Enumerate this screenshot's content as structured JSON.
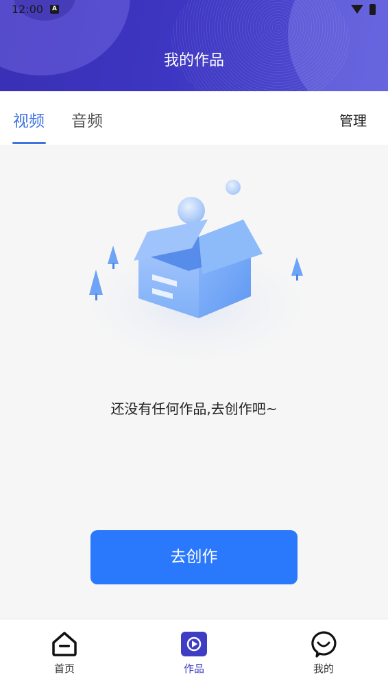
{
  "status_bar": {
    "time": "12:00",
    "notification_glyph": "A"
  },
  "header": {
    "title": "我的作品"
  },
  "tabs": [
    {
      "label": "视频",
      "active": true
    },
    {
      "label": "音频",
      "active": false
    }
  ],
  "manage_label": "管理",
  "empty_state": {
    "message": "还没有任何作品,去创作吧~",
    "illustration_icon": "empty-box-icon"
  },
  "create_button_label": "去创作",
  "bottom_nav": [
    {
      "label": "首页",
      "icon": "home-icon",
      "active": false
    },
    {
      "label": "作品",
      "icon": "play-icon",
      "active": true
    },
    {
      "label": "我的",
      "icon": "smile-face-icon",
      "active": false
    }
  ],
  "colors": {
    "accent": "#3f74e0",
    "button": "#2a78fb",
    "header": "#3d36c2",
    "nav_active": "#3f3dc4"
  }
}
